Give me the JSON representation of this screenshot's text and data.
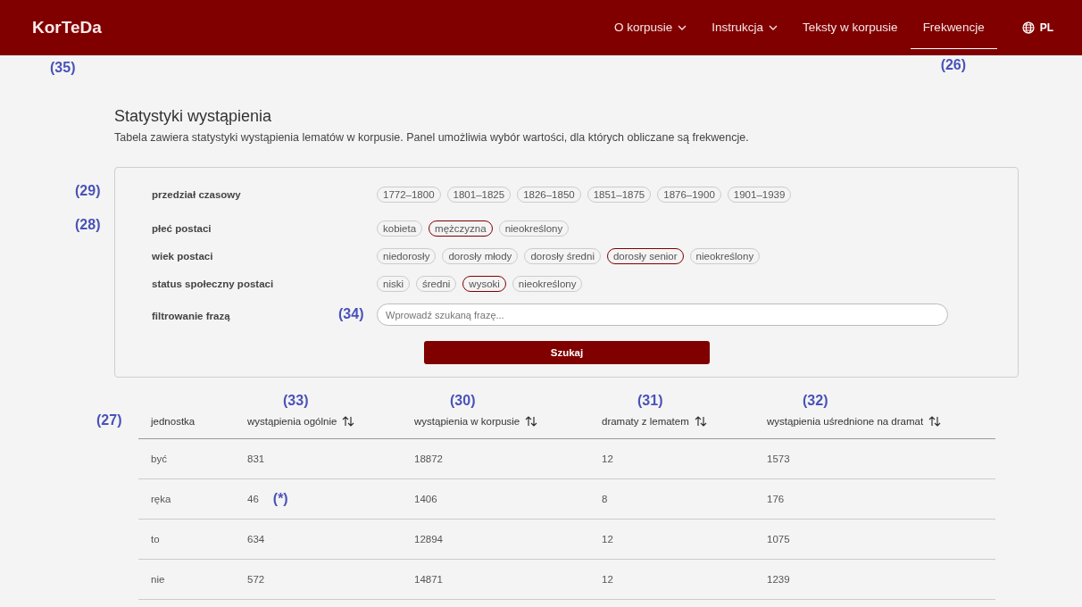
{
  "header": {
    "logo": "KorTeDa",
    "annotation": "(35)",
    "nav": [
      {
        "label": "O korpusie",
        "dropdown": true,
        "selected": false
      },
      {
        "label": "Instrukcja",
        "dropdown": true,
        "selected": false
      },
      {
        "label": "Teksty w korpusie",
        "dropdown": false,
        "selected": false
      },
      {
        "label": "Frekwencje",
        "dropdown": false,
        "selected": true,
        "annotation": "(26)"
      }
    ],
    "language": "PL"
  },
  "title": "Statystyki wystąpienia",
  "description": "Tabela zawiera statystyki wystąpienia lematów w korpusie. Panel umożliwia wybór wartości, dla których obliczane są frekwencje.",
  "filters": [
    {
      "label": "przedział czasowy",
      "annotation": "(29)",
      "options": [
        {
          "label": "1772–1800",
          "selected": false
        },
        {
          "label": "1801–1825",
          "selected": false
        },
        {
          "label": "1826–1850",
          "selected": false
        },
        {
          "label": "1851–1875",
          "selected": false
        },
        {
          "label": "1876–1900",
          "selected": false
        },
        {
          "label": "1901–1939",
          "selected": false
        }
      ]
    },
    {
      "label": "płeć postaci",
      "annotation": "(28)",
      "options": [
        {
          "label": "kobieta",
          "selected": false
        },
        {
          "label": "mężczyzna",
          "selected": true
        },
        {
          "label": "nieokreślony",
          "selected": false
        }
      ]
    },
    {
      "label": "wiek postaci",
      "options": [
        {
          "label": "niedorosły",
          "selected": false
        },
        {
          "label": "dorosły młody",
          "selected": false
        },
        {
          "label": "dorosły średni",
          "selected": false
        },
        {
          "label": "dorosły senior",
          "selected": true
        },
        {
          "label": "nieokreślony",
          "selected": false
        }
      ]
    },
    {
      "label": "status społeczny postaci",
      "options": [
        {
          "label": "niski",
          "selected": false
        },
        {
          "label": "średni",
          "selected": false
        },
        {
          "label": "wysoki",
          "selected": true
        },
        {
          "label": "nieokreślony",
          "selected": false
        }
      ]
    }
  ],
  "phrase_filter": {
    "label": "filtrowanie frazą",
    "annotation": "(34)",
    "placeholder": "Wprowadź szukaną frazę..."
  },
  "search_button": "Szukaj",
  "table": {
    "annotation": "(27)",
    "columns": [
      {
        "label": "jednostka",
        "sortable": false
      },
      {
        "label": "wystąpienia ogólnie",
        "sortable": true,
        "annotation": "(33)"
      },
      {
        "label": "wystąpienia w korpusie",
        "sortable": true,
        "annotation": "(30)"
      },
      {
        "label": "dramaty z lematem",
        "sortable": true,
        "annotation": "(31)"
      },
      {
        "label": "wystąpienia uśrednione na dramat",
        "sortable": true,
        "annotation": "(32)"
      }
    ],
    "rows": [
      {
        "cells": [
          "być",
          "831",
          "18872",
          "12",
          "1573"
        ]
      },
      {
        "cells": [
          "ręka",
          "46",
          "1406",
          "8",
          "176"
        ],
        "note": "(*)"
      },
      {
        "cells": [
          "to",
          "634",
          "12894",
          "12",
          "1075"
        ]
      },
      {
        "cells": [
          "nie",
          "572",
          "14871",
          "12",
          "1239"
        ]
      }
    ]
  }
}
